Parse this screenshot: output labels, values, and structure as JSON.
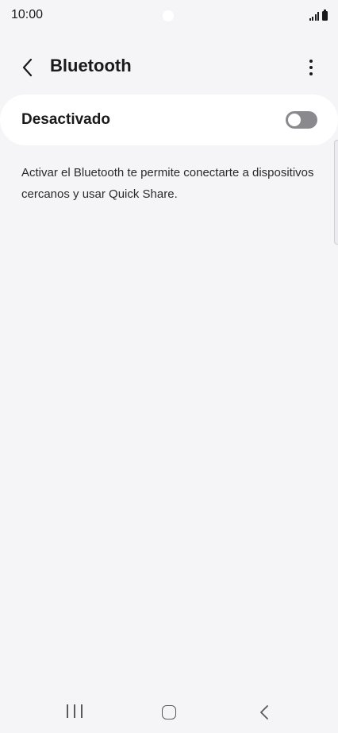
{
  "status_bar": {
    "time": "10:00",
    "icons": [
      "signal-icon",
      "battery-icon"
    ]
  },
  "header": {
    "back_icon": "chevron-left-icon",
    "title": "Bluetooth",
    "more_icon": "more-vertical-icon"
  },
  "bluetooth_toggle": {
    "label": "Desactivado",
    "state": "off"
  },
  "description": "Activar el Bluetooth te permite conectarte a dispositivos cercanos y usar Quick Share.",
  "nav_bar": {
    "icons": [
      "recents-icon",
      "home-icon",
      "back-icon"
    ]
  }
}
